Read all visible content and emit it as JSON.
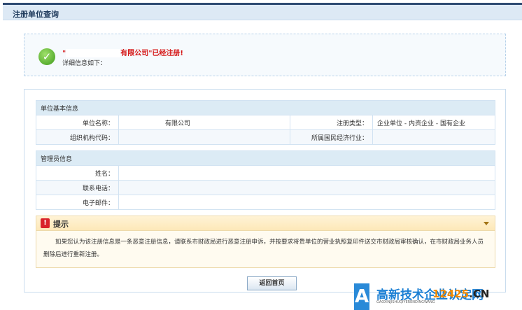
{
  "header": {
    "title": "注册单位查询"
  },
  "success": {
    "quote_open": "\"",
    "message_suffix": "有限公司\"已经注册!",
    "subtext": "详细信息如下："
  },
  "basic": {
    "title": "单位基本信息",
    "name_label": "单位名称：",
    "name_value": "有限公司",
    "type_label": "注册类型：",
    "type_value": "企业单位 - 内资企业 - 国有企业",
    "org_code_label": "组织机构代码：",
    "industry_label": "所属国民经济行业："
  },
  "admin": {
    "title": "管理员信息",
    "name_label": "姓名：",
    "phone_label": "联系电话：",
    "email_label": "电子邮件："
  },
  "tip": {
    "title": "提示",
    "text": "如果您认为该注册信息是一条恶意注册信息，请联系市财政局进行恶意注册申诉，并按要求将贵单位的营业执照复印件送交市财政局审核确认，在市财政局业务人员删除后进行重新注册。"
  },
  "button": {
    "back_label": "返回首页"
  },
  "watermark": {
    "text": "高新技术企业认定网",
    "domain_num": "12425",
    "domain_tld": ".CN",
    "pinyin": "GAOXINJISHUQIYERENDINGWANG"
  },
  "colors": {
    "header_bg": "#dde9f5",
    "error_red": "#d51515",
    "section_bg": "#dcebf5"
  }
}
